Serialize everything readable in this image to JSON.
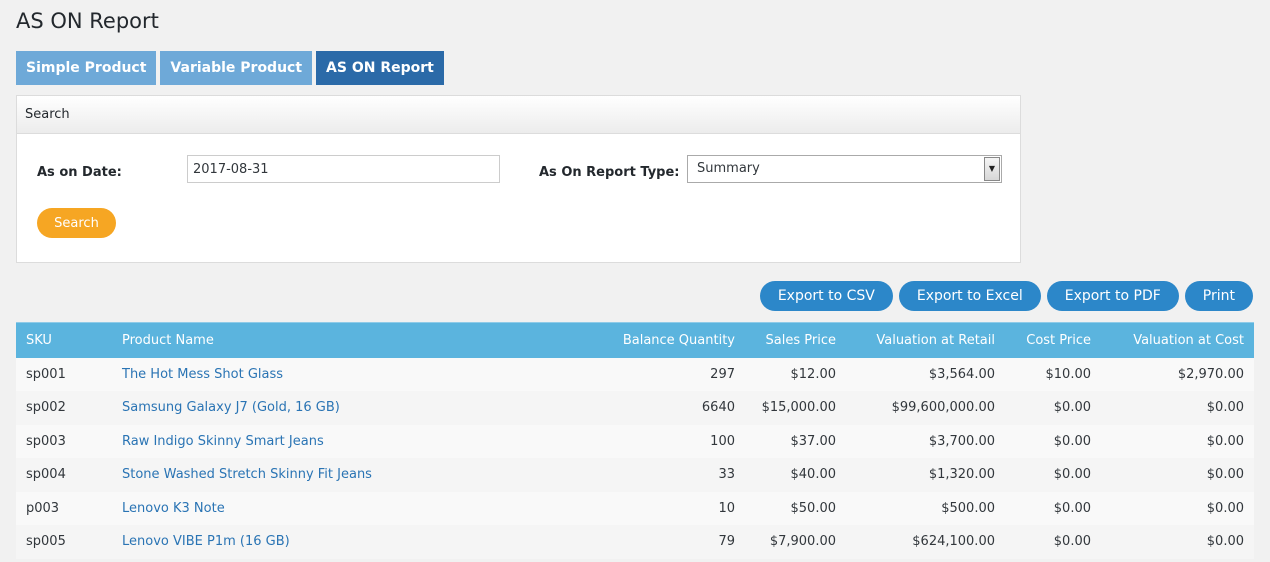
{
  "page": {
    "title": "AS ON Report"
  },
  "tabs": [
    {
      "label": "Simple Product",
      "active": false
    },
    {
      "label": "Variable Product",
      "active": false
    },
    {
      "label": "AS ON Report",
      "active": true
    }
  ],
  "search_panel": {
    "header": "Search",
    "date_label": "As on Date:",
    "date_value": "2017-08-31",
    "type_label": "As On Report Type:",
    "type_value": "Summary",
    "search_button": "Search"
  },
  "export": {
    "csv": "Export to CSV",
    "excel": "Export to Excel",
    "pdf": "Export to PDF",
    "print": "Print"
  },
  "table": {
    "headers": [
      "SKU",
      "Product Name",
      "Balance Quantity",
      "Sales Price",
      "Valuation at Retail",
      "Cost Price",
      "Valuation at Cost"
    ],
    "rows": [
      [
        "sp001",
        "The Hot Mess Shot Glass",
        "297",
        "$12.00",
        "$3,564.00",
        "$10.00",
        "$2,970.00"
      ],
      [
        "sp002",
        "Samsung Galaxy J7 (Gold, 16 GB)",
        "6640",
        "$15,000.00",
        "$99,600,000.00",
        "$0.00",
        "$0.00"
      ],
      [
        "sp003",
        "Raw Indigo Skinny Smart Jeans",
        "100",
        "$37.00",
        "$3,700.00",
        "$0.00",
        "$0.00"
      ],
      [
        "sp004",
        "Stone Washed Stretch Skinny Fit Jeans",
        "33",
        "$40.00",
        "$1,320.00",
        "$0.00",
        "$0.00"
      ],
      [
        "p003",
        "Lenovo K3 Note",
        "10",
        "$50.00",
        "$500.00",
        "$0.00",
        "$0.00"
      ],
      [
        "sp005",
        "Lenovo VIBE P1m (16 GB)",
        "79",
        "$7,900.00",
        "$624,100.00",
        "$0.00",
        "$0.00"
      ]
    ]
  },
  "colors": {
    "tab_inactive": "#6ea9d8",
    "tab_active": "#2b6aa8",
    "search_button": "#f6a623",
    "export_button": "#2c87c9",
    "table_header": "#5bb4de",
    "link": "#2a74b4"
  },
  "icons": {
    "select_arrow": "triangle-down-icon"
  }
}
